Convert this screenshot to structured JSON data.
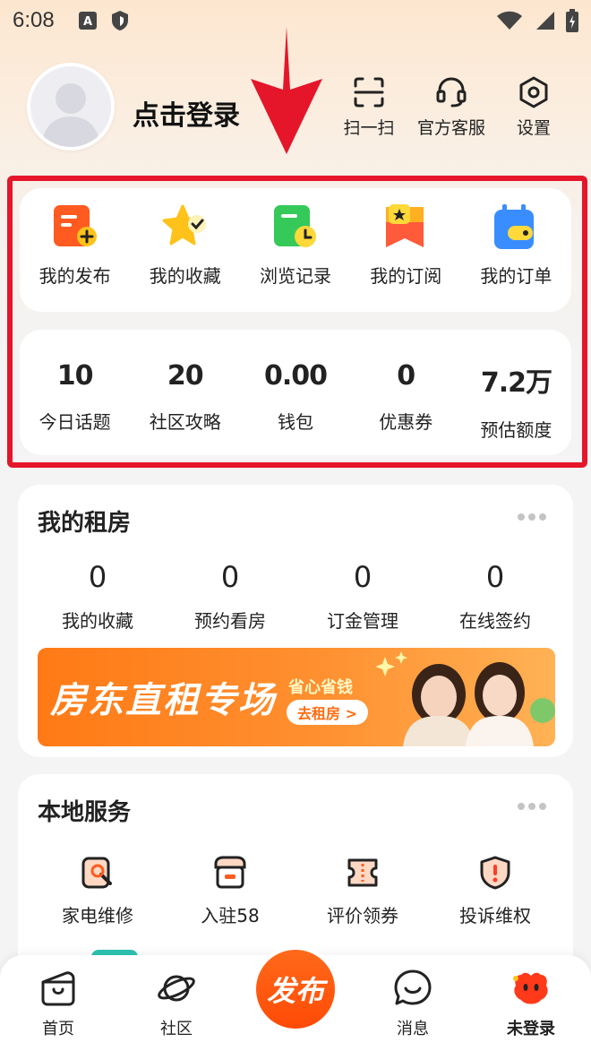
{
  "status_bar": {
    "time": "6:08",
    "left_icons": [
      "font-a-icon",
      "shield-icon"
    ],
    "right_icons": [
      "wifi-icon",
      "signal-icon",
      "battery-icon"
    ]
  },
  "header": {
    "login_text": "点击登录",
    "actions": [
      {
        "label": "扫一扫",
        "icon": "scan-icon"
      },
      {
        "label": "官方客服",
        "icon": "headset-icon"
      },
      {
        "label": "设置",
        "icon": "settings-icon"
      }
    ]
  },
  "quick_links": [
    {
      "label": "我的发布",
      "icon": "publish-doc-icon",
      "color": "#ff5a1f"
    },
    {
      "label": "我的收藏",
      "icon": "star-icon",
      "color": "#ffc21a"
    },
    {
      "label": "浏览记录",
      "icon": "history-icon",
      "color": "#35c95a"
    },
    {
      "label": "我的订阅",
      "icon": "subscribe-icon",
      "color": "#ff5a3a"
    },
    {
      "label": "我的订单",
      "icon": "order-icon",
      "color": "#3a8dff"
    }
  ],
  "stats": [
    {
      "value": "10",
      "label": "今日话题"
    },
    {
      "value": "20",
      "label": "社区攻略"
    },
    {
      "value": "0.00",
      "label": "钱包"
    },
    {
      "value": "0",
      "label": "优惠券"
    },
    {
      "value": "7.2万",
      "label": "预估额度"
    }
  ],
  "rent": {
    "title": "我的租房",
    "items": [
      {
        "value": "0",
        "label": "我的收藏"
      },
      {
        "value": "0",
        "label": "预约看房"
      },
      {
        "value": "0",
        "label": "订金管理"
      },
      {
        "value": "0",
        "label": "在线签约"
      }
    ],
    "banner": {
      "title": "房东直租专场",
      "subtitle": "省心省钱",
      "button": "去租房 >"
    }
  },
  "services": {
    "title": "本地服务",
    "items": [
      {
        "label": "家电维修",
        "icon": "repair-icon"
      },
      {
        "label": "入驻58",
        "icon": "store-icon"
      },
      {
        "label": "评价领券",
        "icon": "coupon-icon"
      },
      {
        "label": "投诉维权",
        "icon": "complaint-icon"
      }
    ]
  },
  "bottom_nav": {
    "items": [
      {
        "label": "首页",
        "icon": "home-bag-icon"
      },
      {
        "label": "社区",
        "icon": "planet-icon"
      },
      {
        "label": "消息",
        "icon": "message-icon"
      },
      {
        "label": "未登录",
        "icon": "mascot-icon"
      }
    ],
    "publish_label": "发布"
  },
  "colors": {
    "accent": "#ff5a0f",
    "highlight_frame": "#e5162a",
    "annotation_arrow": "#e5162a"
  }
}
